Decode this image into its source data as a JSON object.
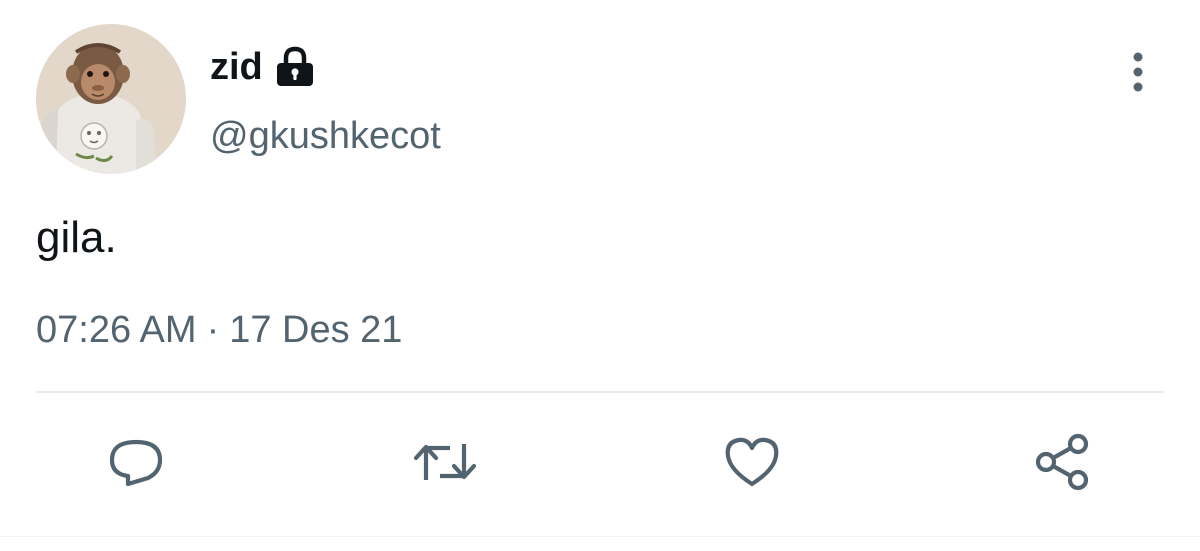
{
  "user": {
    "display_name": "zid",
    "handle": "@gkushkecot",
    "protected_icon": "lock-icon",
    "avatar_icon": "monkey-avatar"
  },
  "tweet": {
    "text": "gila.",
    "time": "07:26 AM",
    "separator": "·",
    "date": "17 Des 21"
  },
  "actions": [
    {
      "name": "reply",
      "icon": "speech-bubble-icon"
    },
    {
      "name": "retweet",
      "icon": "retweet-arrows-icon"
    },
    {
      "name": "like",
      "icon": "heart-icon"
    },
    {
      "name": "share",
      "icon": "share-nodes-icon"
    }
  ],
  "colors": {
    "text_primary": "#0f1419",
    "text_secondary": "#536471",
    "icon": "#536471",
    "divider": "#e6eaed"
  }
}
